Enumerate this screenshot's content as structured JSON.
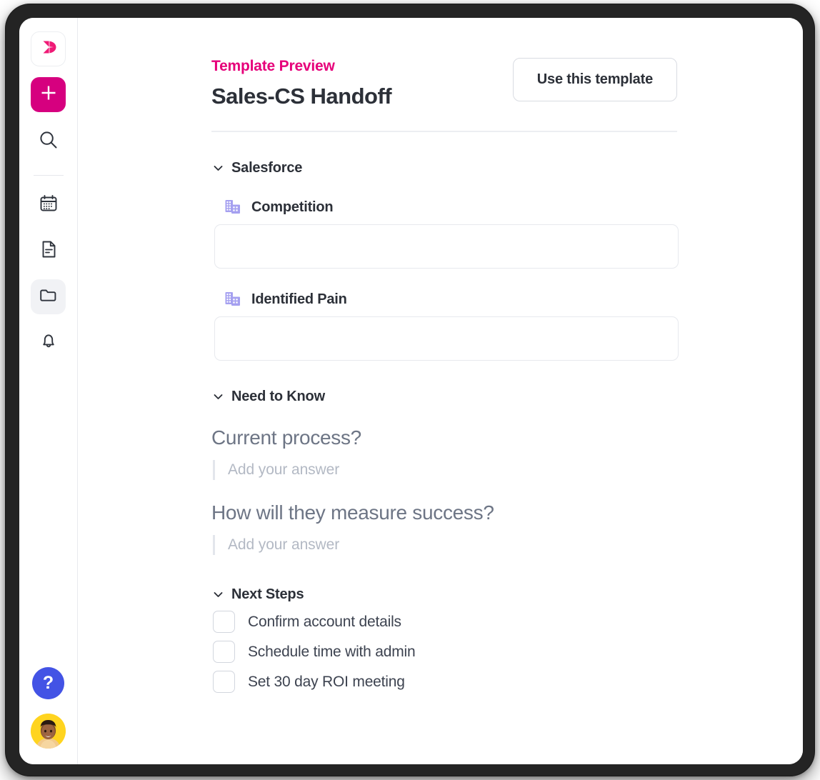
{
  "sidebar": {
    "items": [
      {
        "name": "logo",
        "icon": "brand-logo-icon",
        "label": ""
      },
      {
        "name": "add",
        "icon": "plus-icon",
        "label": ""
      },
      {
        "name": "search",
        "icon": "search-icon",
        "label": ""
      },
      {
        "name": "calendar",
        "icon": "calendar-icon",
        "label": ""
      },
      {
        "name": "documents",
        "icon": "document-icon",
        "label": ""
      },
      {
        "name": "folders",
        "icon": "folder-open-icon",
        "label": ""
      },
      {
        "name": "notifications",
        "icon": "bell-icon",
        "label": ""
      }
    ],
    "help_label": "?",
    "avatar_label": ""
  },
  "header": {
    "eyebrow": "Template Preview",
    "title": "Sales-CS Handoff",
    "action_label": "Use this template"
  },
  "sections": [
    {
      "name": "salesforce",
      "title": "Salesforce",
      "collapse_icon": "chevron-down-icon",
      "fields": [
        {
          "icon": "company-buildings-icon",
          "label": "Competition",
          "value": "",
          "placeholder": ""
        },
        {
          "icon": "company-buildings-icon",
          "label": "Identified Pain",
          "value": "",
          "placeholder": ""
        }
      ]
    },
    {
      "name": "need-to-know",
      "title": "Need to Know",
      "collapse_icon": "chevron-down-icon",
      "questions": [
        {
          "prompt": "Current process?",
          "answer_placeholder": "Add your answer"
        },
        {
          "prompt": "How will they measure success?",
          "answer_placeholder": "Add your answer"
        }
      ]
    },
    {
      "name": "next-steps",
      "title": "Next Steps",
      "collapse_icon": "chevron-down-icon",
      "steps": [
        {
          "label": "Confirm account details",
          "checked": false
        },
        {
          "label": "Schedule time with admin",
          "checked": false
        },
        {
          "label": "Set 30 day ROI meeting",
          "checked": false
        }
      ]
    }
  ],
  "colors": {
    "brand_magenta": "#d6007f",
    "eyebrow_pink": "#e6007a",
    "help_blue": "#4353e5",
    "avatar_yellow": "#ffd41f",
    "field_icon_purple": "#a5a0f0",
    "text_dark": "#2c3038",
    "text_muted": "#6d7585",
    "placeholder_gray": "#b3b9c4",
    "border_gray": "#e7e9ee",
    "bezel_dark": "#242424"
  }
}
